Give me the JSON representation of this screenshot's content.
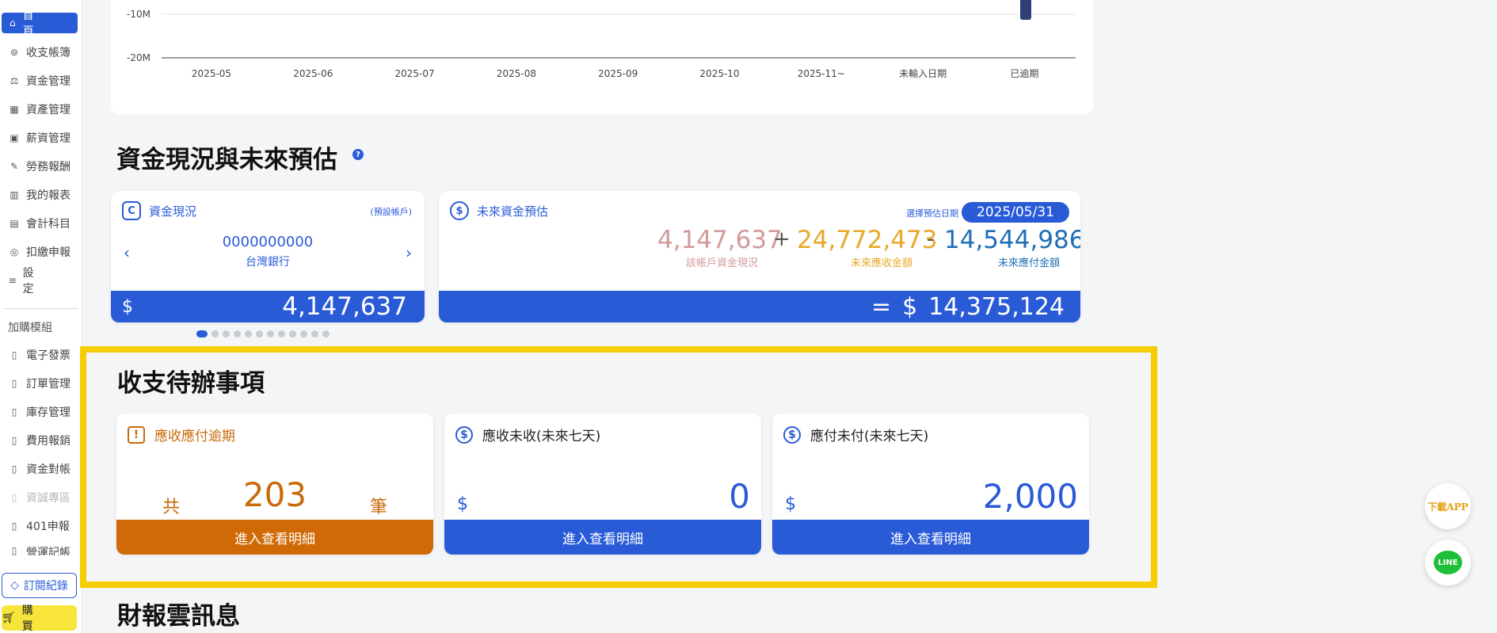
{
  "sidebar": {
    "items": [
      {
        "label": "首　頁",
        "icon": "home-icon",
        "active": true
      },
      {
        "label": "收支帳簿",
        "icon": "ledger-icon"
      },
      {
        "label": "資金管理",
        "icon": "fund-icon"
      },
      {
        "label": "資產管理",
        "icon": "asset-icon"
      },
      {
        "label": "薪資管理",
        "icon": "salary-icon"
      },
      {
        "label": "勞務報酬",
        "icon": "labor-icon"
      },
      {
        "label": "我的報表",
        "icon": "report-icon"
      },
      {
        "label": "會計科目",
        "icon": "account-icon"
      },
      {
        "label": "扣繳申報",
        "icon": "withholding-icon"
      },
      {
        "label": "設　定",
        "icon": "settings-icon"
      }
    ],
    "addon_title": "加購模組",
    "addons": [
      {
        "label": "電子發票",
        "icon": "module-icon"
      },
      {
        "label": "訂單管理",
        "icon": "module-icon"
      },
      {
        "label": "庫存管理",
        "icon": "module-icon"
      },
      {
        "label": "費用報銷",
        "icon": "module-icon"
      },
      {
        "label": "資金對帳",
        "icon": "module-icon"
      },
      {
        "label": "資誠專區",
        "icon": "module-icon",
        "disabled": true
      },
      {
        "label": "401申報",
        "icon": "module-icon"
      },
      {
        "label": "營運記帳",
        "icon": "module-icon"
      }
    ],
    "subscription_label": "訂閱紀錄",
    "buy_label": "購　買"
  },
  "chart_data": {
    "type": "bar",
    "categories": [
      "2025-05",
      "2025-06",
      "2025-07",
      "2025-08",
      "2025-09",
      "2025-10",
      "2025-11~",
      "未輸入日期",
      "已逾期"
    ],
    "ytick_labels": [
      "-10M",
      "-20M"
    ],
    "visible_bar": {
      "category": "已逾期",
      "note_value_range": [
        -11000000,
        0
      ]
    }
  },
  "cash_section": {
    "title": "資金現況與未來預估",
    "help": "?",
    "current": {
      "title": "資金現況",
      "default_tag": "(預設帳戶)",
      "account_no": "0000000000",
      "bank": "台灣銀行",
      "currency": "$",
      "amount": "4,147,637",
      "prev": "‹",
      "next": "›",
      "page_count": 12,
      "active_page": 1
    },
    "future": {
      "title": "未來資金預估",
      "date_label": "選擇預估日期",
      "date": "2025/05/31",
      "current_val": "4,147,637",
      "current_lbl": "該帳戶資金現況",
      "plus": "+",
      "receivable_val": "24,772,473",
      "receivable_lbl": "未來應收金額",
      "minus": "-",
      "payable_val": "14,544,986",
      "payable_lbl": "未來應付金額",
      "equals": "=",
      "currency": "$",
      "result": "14,375,124"
    }
  },
  "todo_section": {
    "title": "收支待辦事項",
    "overdue": {
      "title": "應收應付逾期",
      "prefix": "共",
      "count": "203",
      "suffix": "筆",
      "button": "進入查看明細"
    },
    "receivable": {
      "title": "應收未收(未來七天)",
      "currency": "$",
      "amount": "0",
      "button": "進入查看明細"
    },
    "payable": {
      "title": "應付未付(未來七天)",
      "currency": "$",
      "amount": "2,000",
      "button": "進入查看明細"
    }
  },
  "news_section": {
    "title": "財報雲訊息"
  },
  "floating": {
    "app": "下載APP",
    "line": "LINE"
  },
  "colors": {
    "primary": "#2a5bd7",
    "warning": "#c96a0a",
    "highlight": "#f7cc00",
    "receivable": "#e8a92a",
    "current": "#d39a9a",
    "payable": "#1f6fb8"
  }
}
